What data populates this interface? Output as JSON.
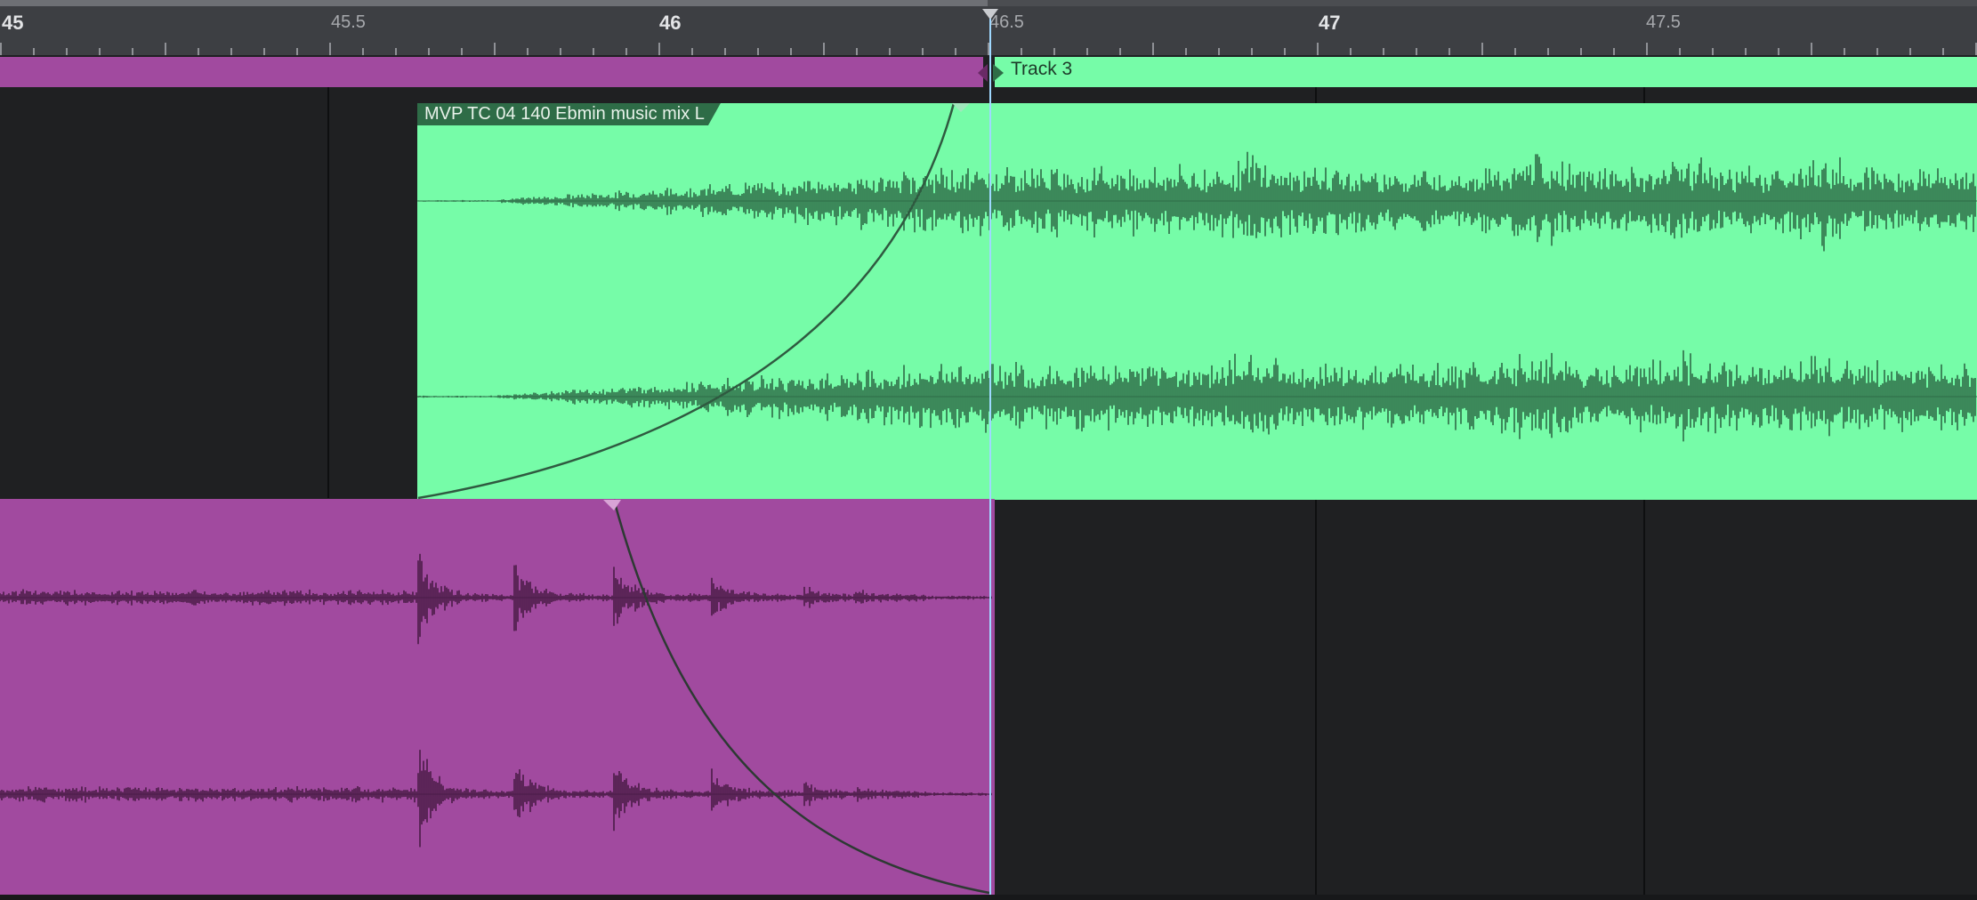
{
  "timeline": {
    "ruler": {
      "labels": [
        "45",
        "45.5",
        "46",
        "46.5",
        "47",
        "47.5"
      ]
    },
    "playhead_position": "46.5"
  },
  "tracks": {
    "track3": {
      "name": "Track 3",
      "color": "#76fca8"
    },
    "previous_track": {
      "color": "#a14a9f"
    }
  },
  "clips": {
    "green_clip": {
      "name": "MVP TC 04 140 Ebmin music mix L",
      "color": "#76fca8",
      "waveform_color": "#2e6c47"
    },
    "purple_clip": {
      "color": "#a14a9f",
      "waveform_color": "#4a1c47"
    }
  },
  "colors": {
    "background": "#1f2022",
    "ruler": "#3d3f43",
    "playhead": "#9fd8ff",
    "crossfade_curve": "#2f5a40"
  }
}
